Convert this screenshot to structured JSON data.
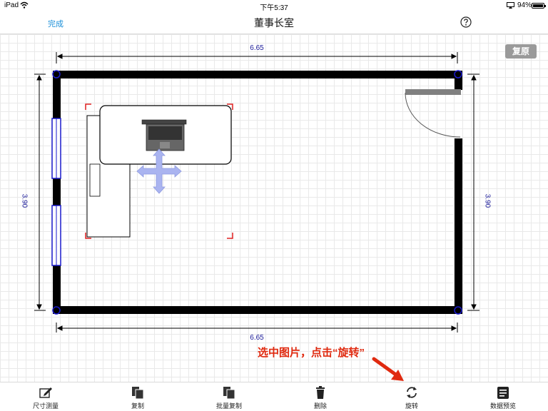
{
  "status_bar": {
    "carrier": "iPad",
    "time": "下午5:37",
    "battery": "94%"
  },
  "nav": {
    "done_label": "完成",
    "title": "董事长室",
    "help_icon": "question-circle-icon"
  },
  "canvas": {
    "restore_label": "复原",
    "dimension_top": "6.65",
    "dimension_bottom": "6.65",
    "dimension_left": "3.90",
    "dimension_right": "3.90",
    "annotation": "选中图片，点击“旋转”",
    "annotation_color": "#e02a10",
    "wall_color": "#000000",
    "window_color": "#1a1acc",
    "selection_color": "#e02020",
    "move_handle_color": "#aab4f0"
  },
  "toolbar": {
    "items": [
      {
        "label": "尺寸测量",
        "icon": "ruler-pencil-icon"
      },
      {
        "label": "复制",
        "icon": "copy-icon"
      },
      {
        "label": "批量复制",
        "icon": "batch-copy-icon"
      },
      {
        "label": "删除",
        "icon": "trash-icon"
      },
      {
        "label": "旋转",
        "icon": "rotate-icon"
      },
      {
        "label": "数据预览",
        "icon": "data-preview-icon"
      }
    ]
  }
}
